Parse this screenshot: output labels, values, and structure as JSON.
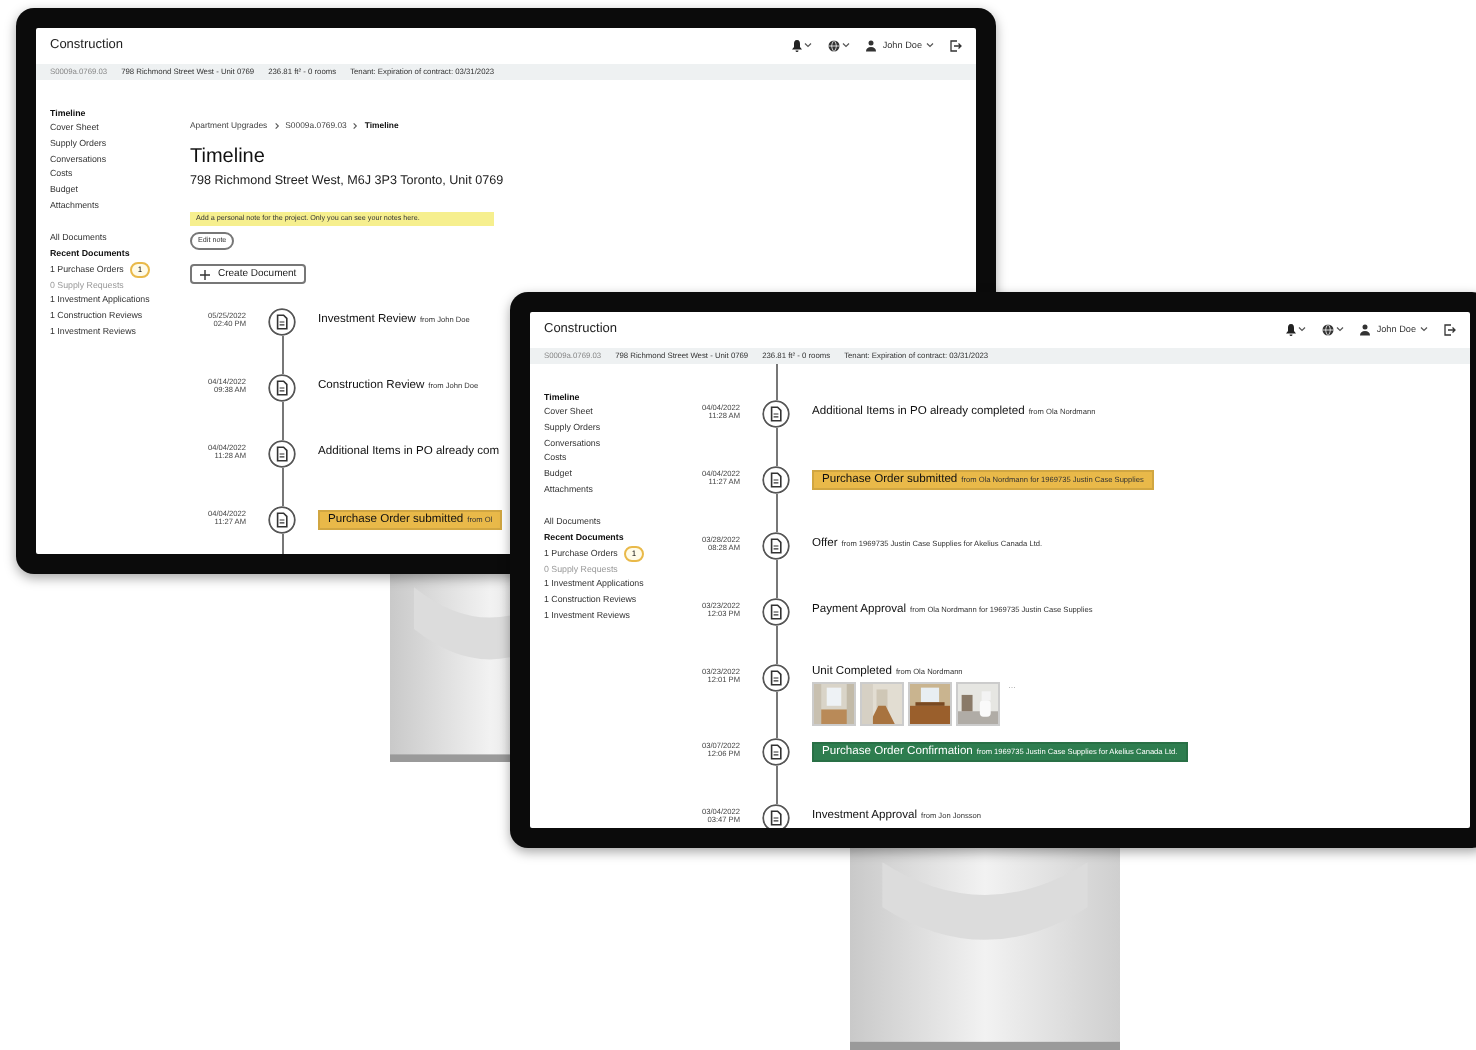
{
  "monitors": [
    {
      "app_title": "Construction",
      "user_name": "John Doe",
      "info_bar": [
        "S0009a.0769.03",
        "798 Richmond Street West - Unit 0769",
        "236.81 ft² - 0 rooms",
        "Tenant: Expiration of contract: 03/31/2023"
      ],
      "nav": [
        {
          "label": "Timeline",
          "kind": "heading"
        },
        {
          "label": "Cover Sheet",
          "kind": "link"
        },
        {
          "label": "Supply Orders",
          "kind": "link"
        },
        {
          "label": "Conversations",
          "kind": "link"
        },
        {
          "label": "Costs",
          "kind": "link"
        },
        {
          "label": "Budget",
          "kind": "link"
        },
        {
          "label": "Attachments",
          "kind": "link"
        }
      ],
      "documents": [
        {
          "label": "All Documents",
          "kind": "link"
        },
        {
          "label": "Recent Documents",
          "kind": "heading"
        },
        {
          "label": "1 Purchase Orders",
          "kind": "link",
          "badge": "1"
        },
        {
          "label": "0 Supply Requests",
          "kind": "inactive"
        },
        {
          "label": "1 Investment Applications",
          "kind": "link"
        },
        {
          "label": "1 Construction Reviews",
          "kind": "link"
        },
        {
          "label": "1 Investment Reviews",
          "kind": "link"
        }
      ],
      "breadcrumb": [
        {
          "label": "Apartment Upgrades",
          "current": false
        },
        {
          "label": "S0009a.0769.03",
          "current": false
        },
        {
          "label": "Timeline",
          "current": true
        }
      ],
      "page_title": "Timeline",
      "address": "798 Richmond Street West, M6J 3P3 Toronto, Unit 0769",
      "note": "Add a personal note for the project. Only you can see your notes here.",
      "edit_note_button": "Edit note",
      "create_button": "Create Document",
      "timeline": [
        {
          "kind": "plain",
          "date": "05/25/2022",
          "time": "02:40 PM",
          "title": "Investment Review",
          "detail": "from John Doe"
        },
        {
          "kind": "plain",
          "date": "04/14/2022",
          "time": "09:38 AM",
          "title": "Construction Review",
          "detail": "from John Doe"
        },
        {
          "kind": "plain",
          "date": "04/04/2022",
          "time": "11:28 AM",
          "title": "Additional Items in PO already com"
        },
        {
          "kind": "banner",
          "color": "#e9b949",
          "date": "04/04/2022",
          "time": "11:27 AM",
          "title": "Purchase Order submitted",
          "detail": "from Ol"
        }
      ]
    },
    {
      "app_title": "Construction",
      "user_name": "John Doe",
      "info_bar": [
        "S0009a.0769.03",
        "798 Richmond Street West - Unit 0769",
        "236.81 ft² - 0 rooms",
        "Tenant: Expiration of contract: 03/31/2023"
      ],
      "nav": [
        {
          "label": "Timeline",
          "kind": "heading"
        },
        {
          "label": "Cover Sheet",
          "kind": "link"
        },
        {
          "label": "Supply Orders",
          "kind": "link"
        },
        {
          "label": "Conversations",
          "kind": "link"
        },
        {
          "label": "Costs",
          "kind": "link"
        },
        {
          "label": "Budget",
          "kind": "link"
        },
        {
          "label": "Attachments",
          "kind": "link"
        }
      ],
      "documents": [
        {
          "label": "All Documents",
          "kind": "link"
        },
        {
          "label": "Recent Documents",
          "kind": "heading"
        },
        {
          "label": "1 Purchase Orders",
          "kind": "link",
          "badge": "1"
        },
        {
          "label": "0 Supply Requests",
          "kind": "inactive"
        },
        {
          "label": "1 Investment Applications",
          "kind": "link"
        },
        {
          "label": "1 Construction Reviews",
          "kind": "link"
        },
        {
          "label": "1 Investment Reviews",
          "kind": "link"
        }
      ],
      "timeline": [
        {
          "kind": "plain",
          "date": "04/04/2022",
          "time": "11:28 AM",
          "title": "Additional Items in PO already completed",
          "detail": "from Ola Nordmann"
        },
        {
          "kind": "banner",
          "color": "#e9b949",
          "date": "04/04/2022",
          "time": "11:27 AM",
          "title": "Purchase Order submitted",
          "detail": "from Ola Nordmann for 1969735 Justin Case Supplies"
        },
        {
          "kind": "plain",
          "date": "03/28/2022",
          "time": "08:28 AM",
          "title": "Offer",
          "detail": "from 1969735 Justin Case Supplies for Akelius Canada Ltd."
        },
        {
          "kind": "plain",
          "date": "03/23/2022",
          "time": "12:03 PM",
          "title": "Payment Approval",
          "detail": "from Ola Nordmann for 1969735 Justin Case Supplies"
        },
        {
          "kind": "photos",
          "date": "03/23/2022",
          "time": "12:01 PM",
          "title": "Unit Completed",
          "detail": "from Ola Nordmann",
          "more": "…"
        },
        {
          "kind": "banner",
          "color": "#2e7d4f",
          "date": "03/07/2022",
          "time": "12:06 PM",
          "title": "Purchase Order Confirmation",
          "detail": "from 1969735 Justin Case Supplies for Akelius Canada Ltd."
        },
        {
          "kind": "plain",
          "date": "03/04/2022",
          "time": "03:47 PM",
          "title": "Investment Approval",
          "detail": "from Jon Jonsson"
        }
      ]
    }
  ]
}
